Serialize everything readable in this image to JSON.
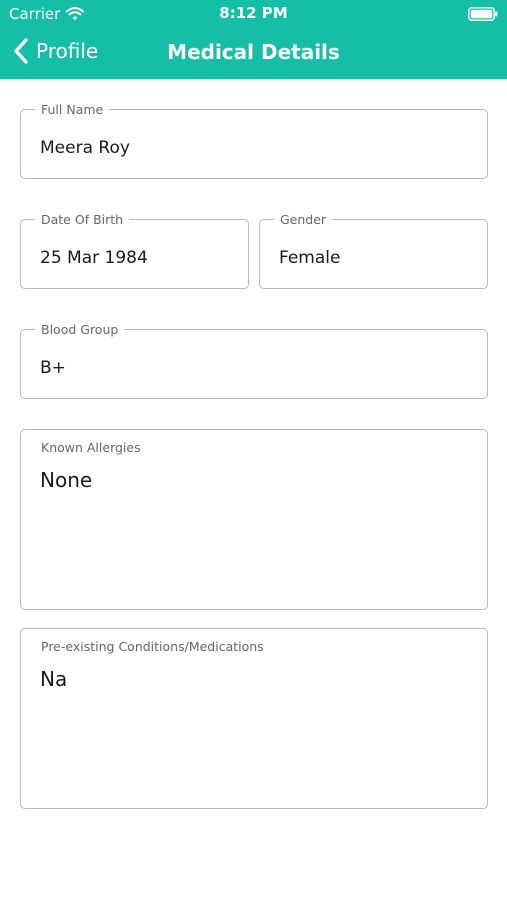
{
  "status_bar": {
    "carrier": "Carrier",
    "time": "8:12 PM"
  },
  "nav": {
    "back_label": "Profile",
    "title": "Medical Details"
  },
  "form": {
    "full_name": {
      "label": "Full Name",
      "value": "Meera Roy"
    },
    "date_of_birth": {
      "label": "Date Of Birth",
      "value": "25 Mar 1984"
    },
    "gender": {
      "label": "Gender",
      "value": "Female"
    },
    "blood_group": {
      "label": "Blood Group",
      "value": "B+"
    },
    "known_allergies": {
      "label": "Known Allergies",
      "value": "None"
    },
    "conditions": {
      "label": "Pre-existing Conditions/Medications",
      "value": "Na"
    }
  },
  "colors": {
    "header": "#14bfa6",
    "border": "#b9b9b9",
    "label": "#666666"
  },
  "icons": [
    "wifi-icon",
    "battery-icon",
    "chevron-left-icon"
  ]
}
